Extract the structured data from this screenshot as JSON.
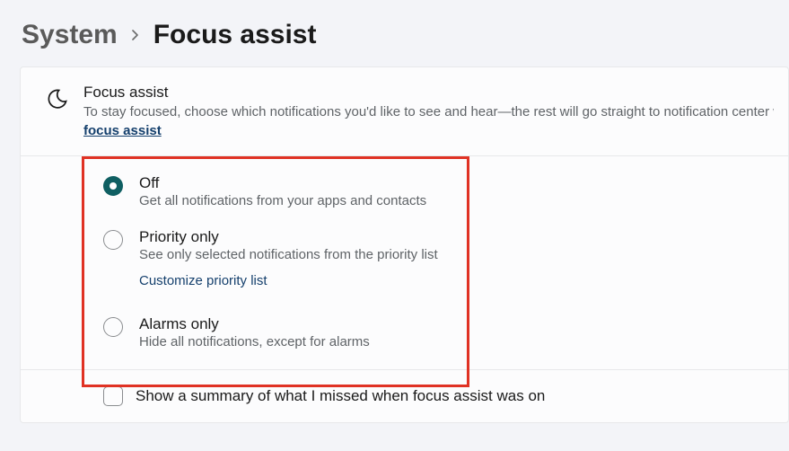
{
  "breadcrumb": {
    "parent": "System",
    "current": "Focus assist"
  },
  "header": {
    "title": "Focus assist",
    "description": "To stay focused, choose which notifications you'd like to see and hear—the rest will go straight to notification center where you can see them any time.",
    "link_text": "focus assist"
  },
  "options": [
    {
      "title": "Off",
      "description": "Get all notifications from your apps and contacts",
      "selected": true
    },
    {
      "title": "Priority only",
      "description": "See only selected notifications from the priority list",
      "selected": false,
      "link": "Customize priority list"
    },
    {
      "title": "Alarms only",
      "description": "Hide all notifications, except for alarms",
      "selected": false
    }
  ],
  "summary": {
    "label": "Show a summary of what I missed when focus assist was on",
    "checked": false
  }
}
